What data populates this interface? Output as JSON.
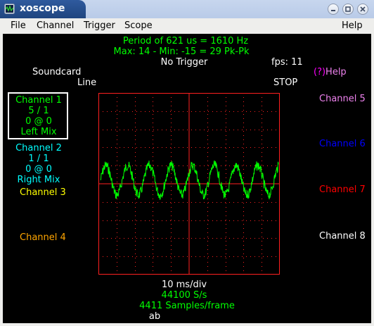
{
  "window": {
    "title": "xoscope"
  },
  "menubar": {
    "file": "File",
    "channel": "Channel",
    "trigger": "Trigger",
    "scope": "Scope",
    "help": "Help"
  },
  "scope": {
    "period_line": "Period of    621 us =    1610 Hz",
    "maxmin_line": "Max: 14 - Min: -15 =  29 Pk-Pk",
    "trigger_status": "No Trigger",
    "fps": "fps: 11",
    "source_name": "Soundcard",
    "source_mode": "Line",
    "help_label": "(?)Help",
    "run_state": "STOP",
    "timebase": "10 ms/div",
    "sample_rate": "44100 S/s",
    "samples_per_frame": "4411 Samples/frame",
    "bottom_text": "ab",
    "colors": {
      "background": "#000000",
      "graticule": "#ff2020",
      "trace": "#00ff00"
    },
    "channels": [
      {
        "name": "Channel 1",
        "scale": "5 / 1",
        "position": "0 @ 0",
        "source": "Left Mix",
        "color": "#00ff00",
        "selected": true
      },
      {
        "name": "Channel 2",
        "scale": "1 / 1",
        "position": "0 @ 0",
        "source": "Right Mix",
        "color": "#00ffff"
      },
      {
        "name": "Channel 3",
        "color": "#ffff00"
      },
      {
        "name": "Channel 4",
        "color": "#ffa500"
      },
      {
        "name": "Channel 5",
        "color": "#ee82ee"
      },
      {
        "name": "Channel 6",
        "color": "#0000ff"
      },
      {
        "name": "Channel 7",
        "color": "#ff0000"
      },
      {
        "name": "Channel 8",
        "color": "#ffffff"
      }
    ]
  }
}
